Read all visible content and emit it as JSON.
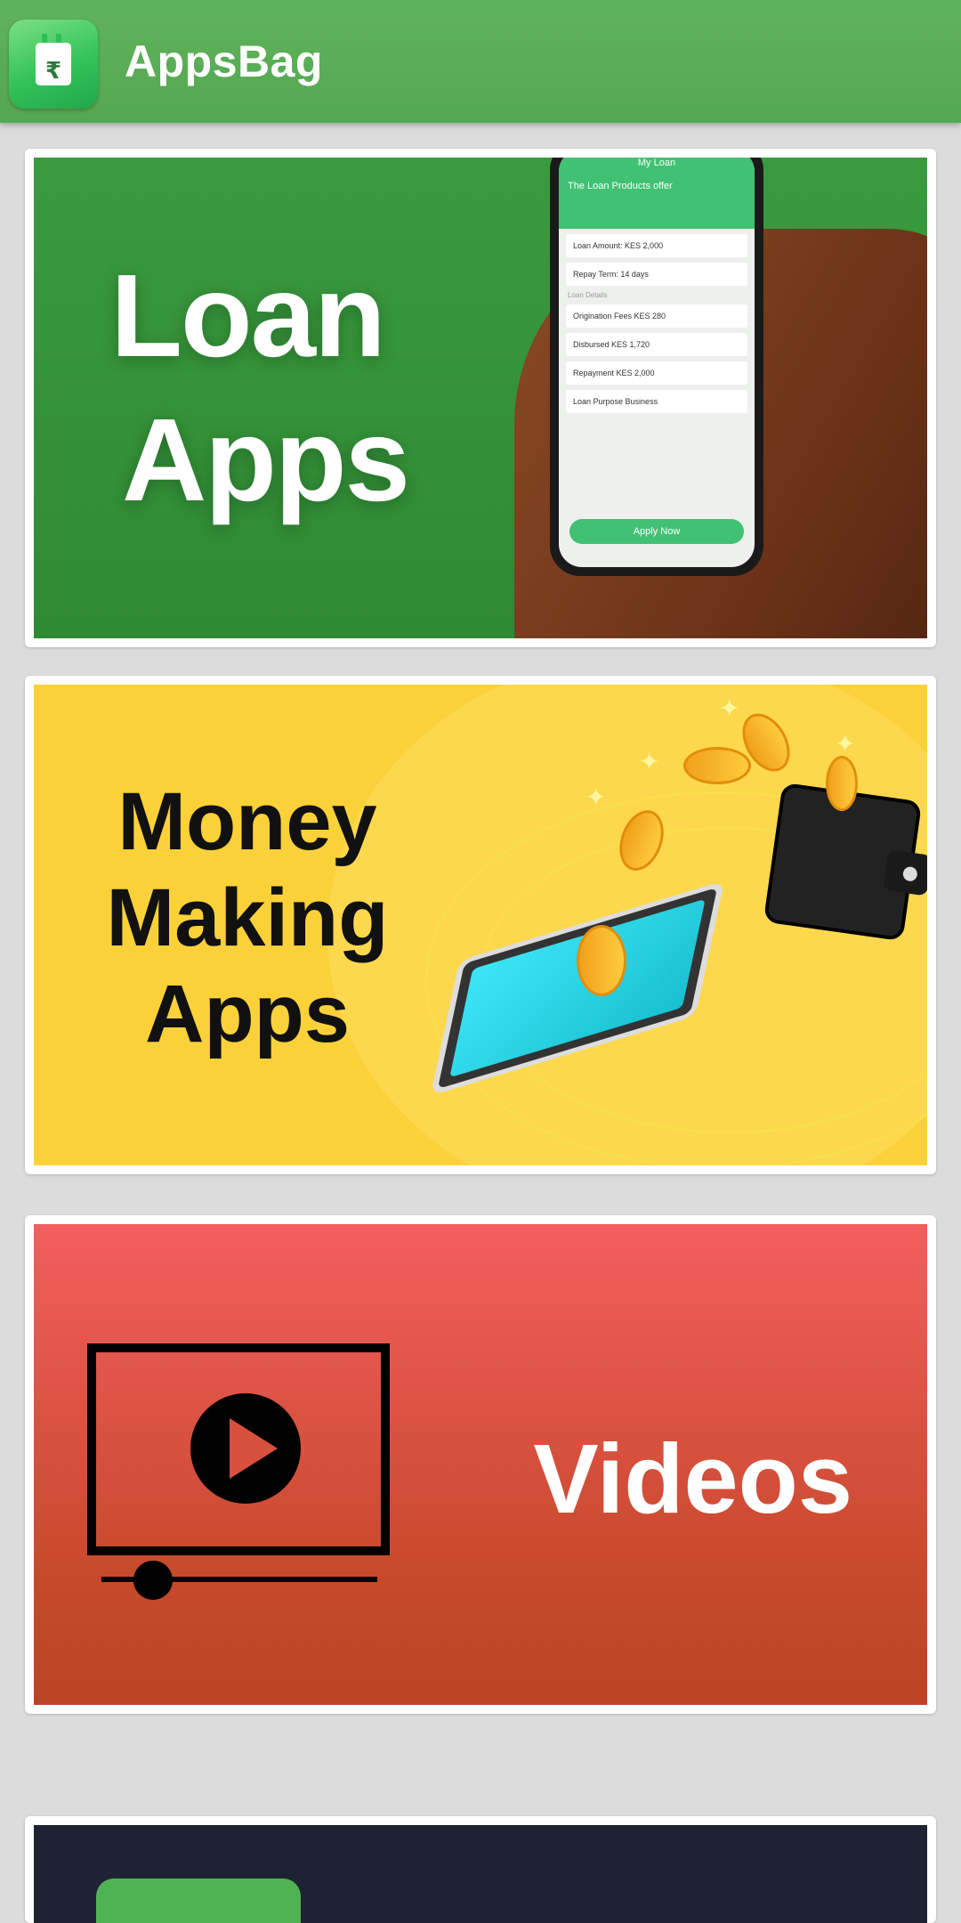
{
  "app": {
    "title": "AppsBag",
    "logo_icon": "shopping-bag-rupee-icon",
    "logo_symbol": "₹"
  },
  "cards": [
    {
      "title_lines": [
        "Loan",
        "Apps"
      ],
      "phone": {
        "header": "My Loan",
        "subheader": "The Loan Products offer",
        "loan_amount": "Loan Amount:  KES 2,000",
        "repay_term": "Repay Term:  14 days",
        "details_label": "Loan Details",
        "rows": [
          "Origination Fees  KES 280",
          "Disbursed  KES 1,720",
          "Repayment  KES 2,000",
          "Loan Purpose  Business"
        ],
        "button": "Apply Now"
      }
    },
    {
      "title_lines": [
        "Money",
        "Making",
        "Apps"
      ]
    },
    {
      "title_lines": [
        "Videos"
      ],
      "icon": "video-player-icon"
    }
  ],
  "colors": {
    "appbar": "#5fb35a",
    "card1": "#3a9a3e",
    "card2": "#fbd13a",
    "card3": "#e0543f",
    "card4": "#1e2333"
  }
}
